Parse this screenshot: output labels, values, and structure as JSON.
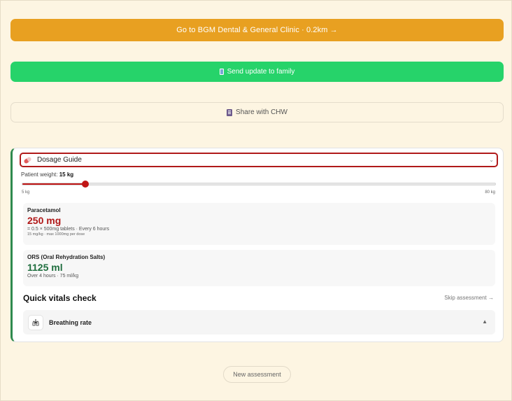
{
  "actions": {
    "clinic_label": "Go to BGM Dental & General Clinic · 0.2km →",
    "family_label": "Send update to family",
    "chw_label": "Share with CHW"
  },
  "dosage": {
    "select_label": "Dosage Guide",
    "weight_prefix": "Patient weight: ",
    "weight_value": "15 kg",
    "weight_kg": 15,
    "slider_min": "5 kg",
    "slider_max": "80 kg",
    "slider_min_value": 5,
    "slider_max_value": 80,
    "meds": [
      {
        "name": "Paracetamol",
        "dose": "250 mg",
        "detail": "= 0.5 × 500mg tablets · Every 6 hours",
        "note": "15 mg/kg · max 1000mg per dose"
      },
      {
        "name": "ORS (Oral Rehydration Salts)",
        "dose": "1125 ml",
        "detail": "Over 4 hours · 75 ml/kg"
      }
    ]
  },
  "vitals": {
    "title": "Quick vitals check",
    "skip_label": "Skip assessment →",
    "breathing_label": "Breathing rate"
  },
  "footer": {
    "new_assessment_label": "New assessment"
  },
  "icons": {
    "family": "mobile-phone-icon",
    "chw": "document-icon",
    "dosage": "pill-icon",
    "breathing": "lungs-icon"
  },
  "colors": {
    "clinic_button": "#e8a021",
    "family_button": "#26d36a",
    "accent_red": "#b01818",
    "accent_green": "#1f6e3e"
  }
}
